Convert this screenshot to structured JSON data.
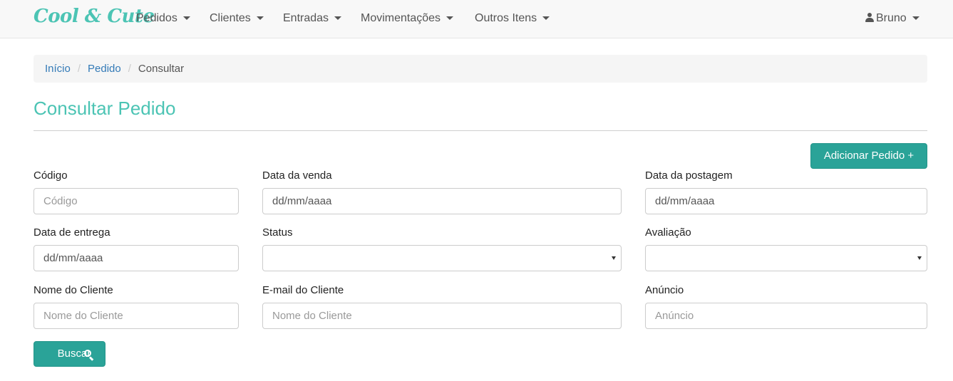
{
  "navbar": {
    "brand": "Cool & Cute",
    "items": [
      {
        "label": "Pedidos"
      },
      {
        "label": "Clientes"
      },
      {
        "label": "Entradas"
      },
      {
        "label": "Movimentações"
      },
      {
        "label": "Outros Itens"
      }
    ],
    "user": {
      "label": "Bruno",
      "icon": "user-icon"
    }
  },
  "breadcrumb": {
    "items": [
      "Início",
      "Pedido"
    ],
    "separator": "/",
    "active": "Consultar"
  },
  "page": {
    "title": "Consultar Pedido",
    "add_button": "Adicionar Pedido +"
  },
  "form": {
    "codigo": {
      "label": "Código",
      "placeholder": "Código"
    },
    "data_venda": {
      "label": "Data da venda",
      "value": "dd/mm/aaaa"
    },
    "data_postagem": {
      "label": "Data da postagem",
      "value": "dd/mm/aaaa"
    },
    "data_entrega": {
      "label": "Data de entrega",
      "value": "dd/mm/aaaa"
    },
    "status": {
      "label": "Status",
      "value": ""
    },
    "avaliacao": {
      "label": "Avaliação",
      "value": ""
    },
    "nome_cliente": {
      "label": "Nome do Cliente",
      "placeholder": "Nome do Cliente"
    },
    "email_cliente": {
      "label": "E-mail do Cliente",
      "placeholder": "Nome do Cliente"
    },
    "anuncio": {
      "label": "Anúncio",
      "placeholder": "Anúncio"
    },
    "search_button": "Buscar",
    "search_icon": "search-icon"
  },
  "colors": {
    "accent": "#4cc4b4",
    "button": "#2aa398",
    "link": "#337ab7"
  }
}
